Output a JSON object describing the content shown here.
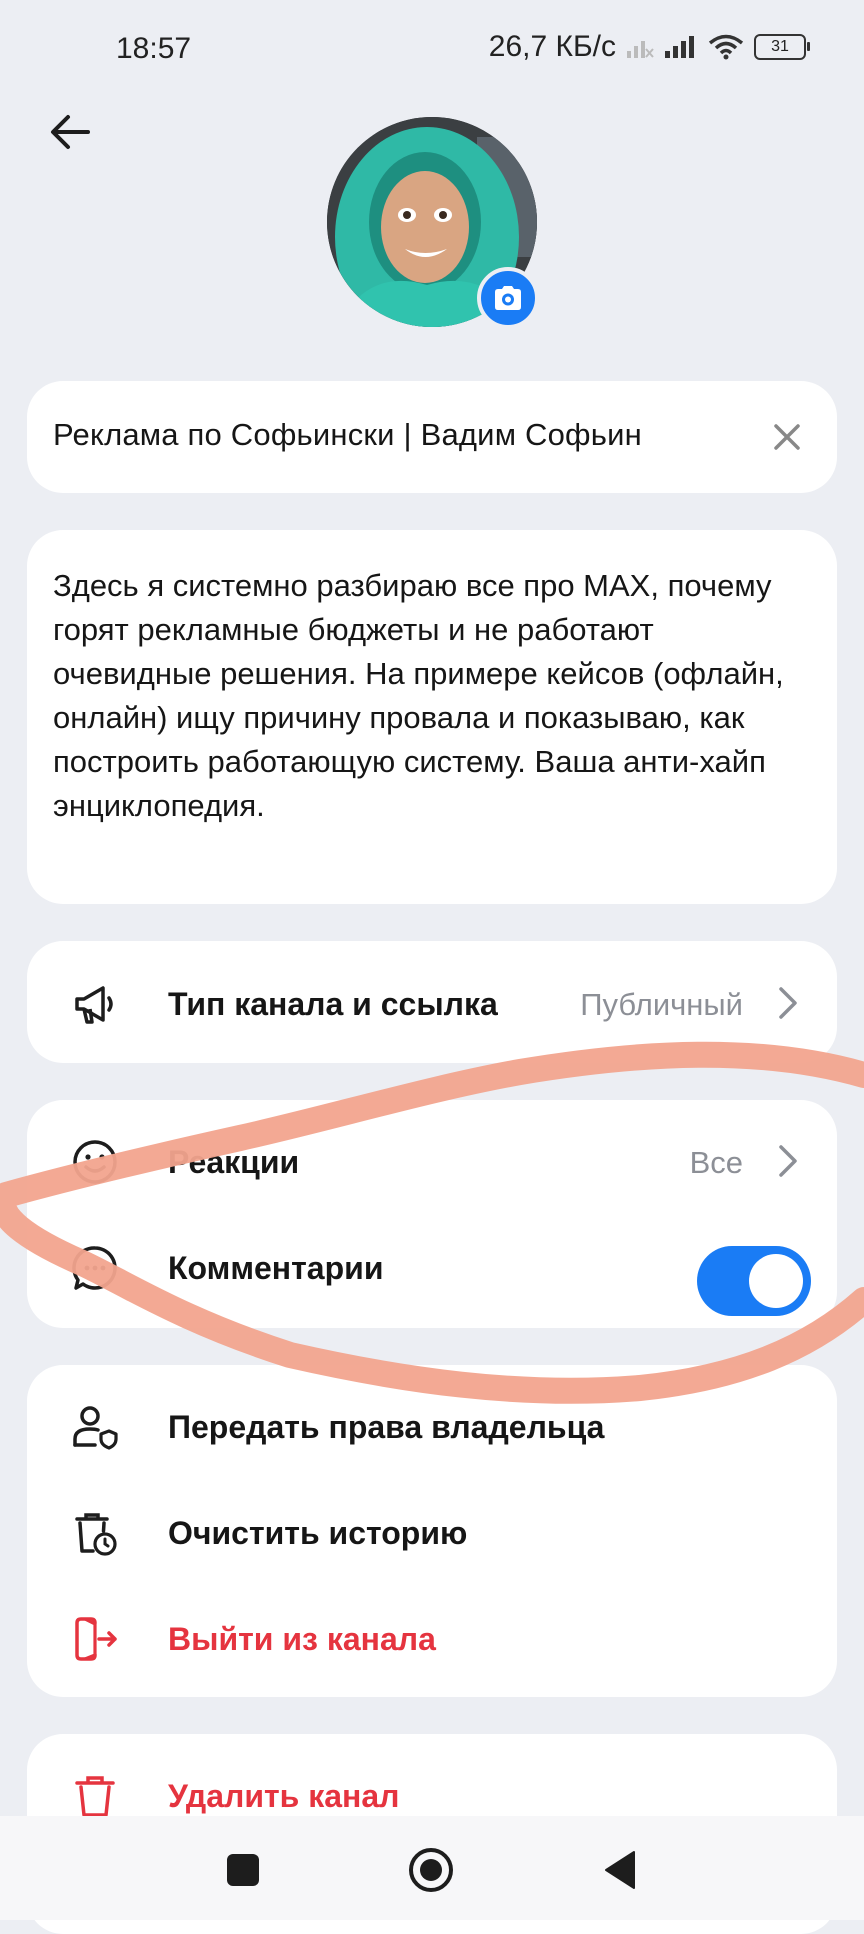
{
  "status_bar": {
    "time": "18:57",
    "net_speed": "26,7 КБ/с",
    "battery": "31"
  },
  "header": {
    "back_icon": "arrow-left-icon",
    "camera_icon": "camera-icon"
  },
  "channel": {
    "name": "Реклама по Софьински | Вадим Софьин",
    "description": "Здесь я системно разбираю все про МАХ, почему горят рекламные бюджеты и не работают очевидные решения. На примере кейсов (офлайн, онлайн) ищу причину провала и показываю, как построить работающую систему. Ваша анти-хайп энциклопедия."
  },
  "settings": {
    "type": {
      "label": "Тип канала и ссылка",
      "value": "Публичный",
      "icon": "megaphone-icon"
    },
    "reactions": {
      "label": "Реакции",
      "value": "Все",
      "icon": "smile-icon"
    },
    "comments": {
      "label": "Комментарии",
      "enabled": true,
      "icon": "comment-icon"
    }
  },
  "actions": {
    "transfer": {
      "label": "Передать права владельца",
      "icon": "user-shield-icon"
    },
    "clear": {
      "label": "Очистить историю",
      "icon": "trash-clock-icon"
    },
    "leave": {
      "label": "Выйти из канала",
      "icon": "exit-icon"
    },
    "delete": {
      "label": "Удалить канал",
      "icon": "trash-icon"
    }
  },
  "colors": {
    "accent": "#1a7cf5",
    "danger": "#e5343f",
    "background": "#eceef3",
    "annotation": "#f2a48e"
  }
}
